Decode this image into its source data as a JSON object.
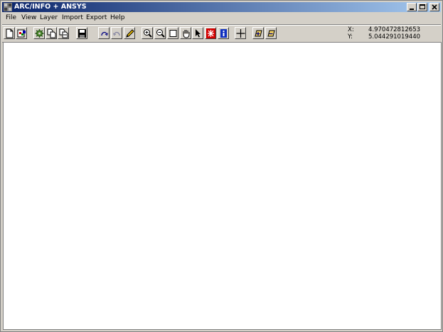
{
  "window": {
    "title": "ARC/INFO + ANSYS"
  },
  "menu": {
    "file": "File",
    "view": "View",
    "layer": "Layer",
    "import": "Import",
    "export": "Export",
    "help": "Help"
  },
  "toolbar": {
    "tools": [
      "new",
      "open",
      "settings",
      "copy",
      "paste",
      "save",
      "redo",
      "undo",
      "edit",
      "zoom-in",
      "zoom-out",
      "zoom-box",
      "pan",
      "select",
      "delete",
      "info",
      "crosshair",
      "add-layer",
      "remove-layer"
    ]
  },
  "coords": {
    "x_label": "X:",
    "x_value": "4.970472812653",
    "y_label": "Y:",
    "y_value": "5.044291019440"
  },
  "colors": {
    "title_start": "#0a246a",
    "title_end": "#a6caf0",
    "chrome": "#d4d0c8",
    "canvas": "#ffffff"
  }
}
